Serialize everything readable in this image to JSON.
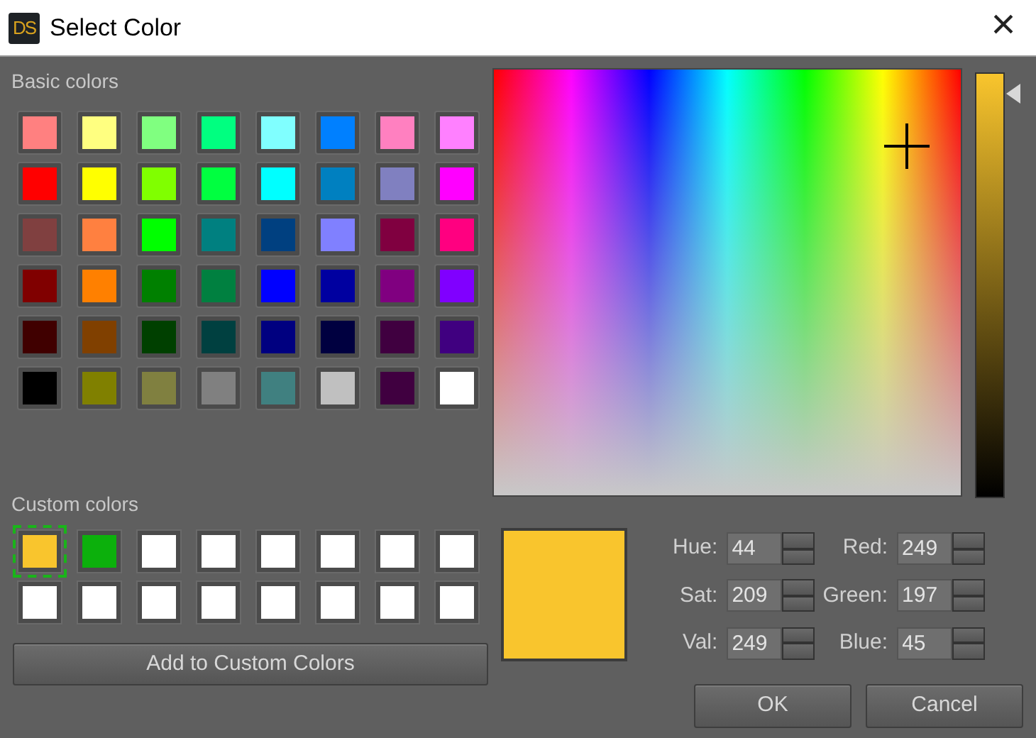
{
  "window": {
    "icon_text": "DS",
    "title": "Select Color",
    "close": "×"
  },
  "basic_colors": {
    "label": "Basic colors",
    "swatches": [
      {
        "color": "#ff8080"
      },
      {
        "color": "#ffff80"
      },
      {
        "color": "#80ff80"
      },
      {
        "color": "#00ff80"
      },
      {
        "color": "#80ffff"
      },
      {
        "color": "#0080ff"
      },
      {
        "color": "#ff80c0"
      },
      {
        "color": "#ff80ff"
      },
      {
        "color": "#ff0000"
      },
      {
        "color": "#ffff00"
      },
      {
        "color": "#80ff00"
      },
      {
        "color": "#00ff40"
      },
      {
        "color": "#00ffff"
      },
      {
        "color": "#0080c0"
      },
      {
        "color": "#8080c0"
      },
      {
        "color": "#ff00ff"
      },
      {
        "color": "#804040"
      },
      {
        "color": "#ff8040"
      },
      {
        "color": "#00ff00"
      },
      {
        "color": "#008080"
      },
      {
        "color": "#004080"
      },
      {
        "color": "#8080ff"
      },
      {
        "color": "#800040"
      },
      {
        "color": "#ff0080"
      },
      {
        "color": "#800000"
      },
      {
        "color": "#ff8000"
      },
      {
        "color": "#008000"
      },
      {
        "color": "#008040"
      },
      {
        "color": "#0000ff"
      },
      {
        "color": "#0000a0"
      },
      {
        "color": "#800080"
      },
      {
        "color": "#8000ff"
      },
      {
        "color": "#400000"
      },
      {
        "color": "#804000"
      },
      {
        "color": "#004000"
      },
      {
        "color": "#004040"
      },
      {
        "color": "#000080"
      },
      {
        "color": "#000040"
      },
      {
        "color": "#400040"
      },
      {
        "color": "#400080"
      },
      {
        "color": "#000000"
      },
      {
        "color": "#808000"
      },
      {
        "color": "#808040"
      },
      {
        "color": "#808080"
      },
      {
        "color": "#408080"
      },
      {
        "color": "#c0c0c0"
      },
      {
        "color": "#400040"
      },
      {
        "color": "#ffffff"
      }
    ]
  },
  "custom_colors": {
    "label": "Custom colors",
    "swatches": [
      {
        "color": "#f9c52d",
        "selected": true
      },
      {
        "color": "#0cb00c",
        "selected": false
      },
      {
        "color": "#ffffff",
        "selected": false
      },
      {
        "color": "#ffffff",
        "selected": false
      },
      {
        "color": "#ffffff",
        "selected": false
      },
      {
        "color": "#ffffff",
        "selected": false
      },
      {
        "color": "#ffffff",
        "selected": false
      },
      {
        "color": "#ffffff",
        "selected": false
      },
      {
        "color": "#ffffff",
        "selected": false
      },
      {
        "color": "#ffffff",
        "selected": false
      },
      {
        "color": "#ffffff",
        "selected": false
      },
      {
        "color": "#ffffff",
        "selected": false
      },
      {
        "color": "#ffffff",
        "selected": false
      },
      {
        "color": "#ffffff",
        "selected": false
      },
      {
        "color": "#ffffff",
        "selected": false
      },
      {
        "color": "#ffffff",
        "selected": false
      }
    ],
    "add_button": "Add to Custom Colors"
  },
  "value_slider": {
    "level": 0.975
  },
  "preview": {
    "color": "#f9c52d"
  },
  "fields": [
    {
      "label": "Hue:",
      "value": "44"
    },
    {
      "label": "Red:",
      "value": "249"
    },
    {
      "label": "Sat:",
      "value": "209"
    },
    {
      "label": "Green:",
      "value": "197"
    },
    {
      "label": "Val:",
      "value": "249"
    },
    {
      "label": "Blue:",
      "value": "45"
    }
  ],
  "buttons": [
    "OK",
    "Cancel"
  ]
}
